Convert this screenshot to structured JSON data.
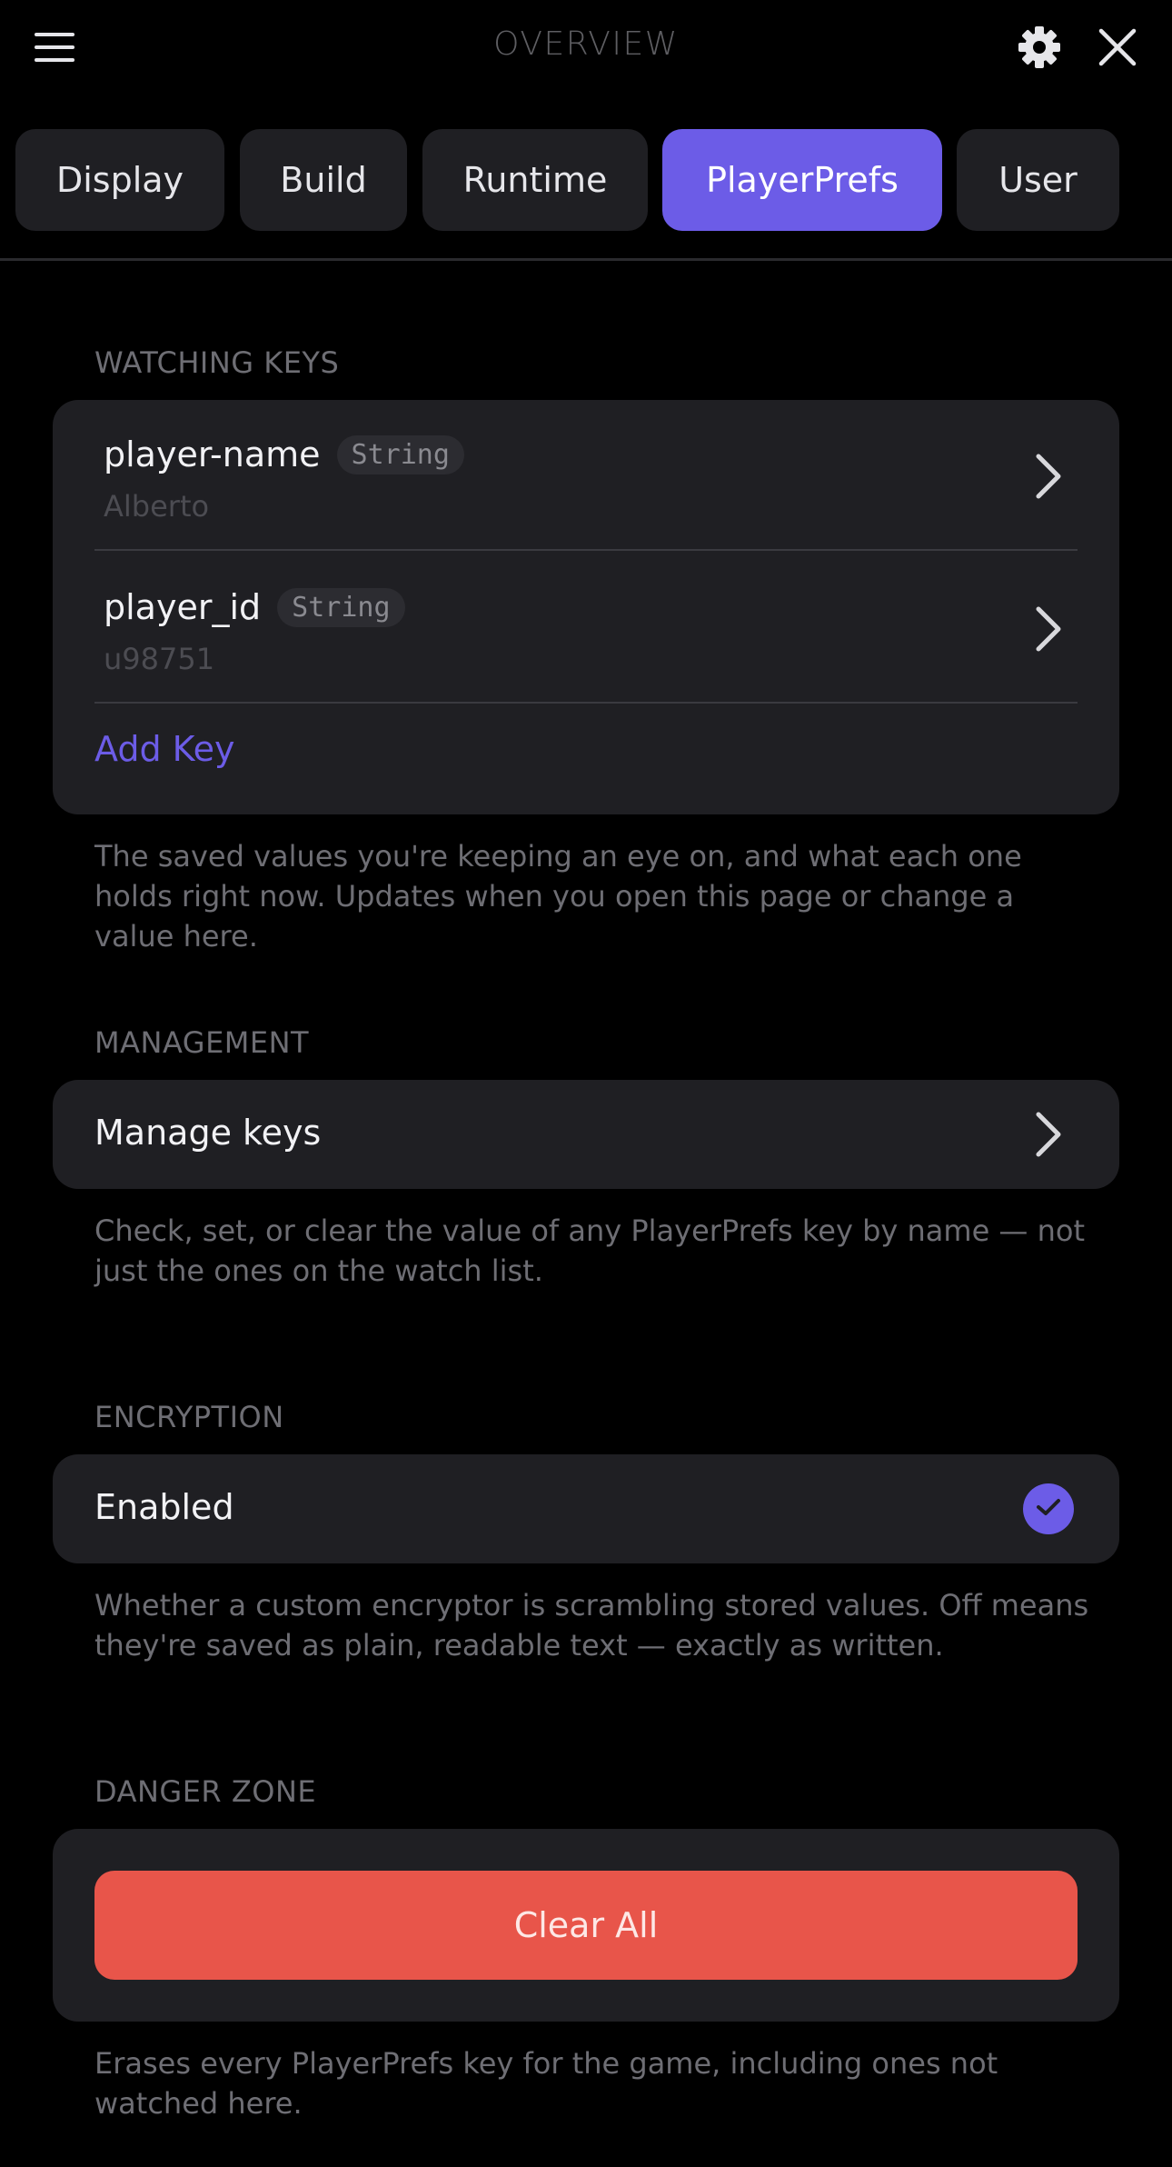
{
  "header": {
    "title": "OVERVIEW",
    "menu_icon": "hamburger-menu-icon",
    "settings_icon": "gear-icon",
    "close_icon": "close-icon"
  },
  "tabs": [
    {
      "label": "Display",
      "active": false
    },
    {
      "label": "Build",
      "active": false
    },
    {
      "label": "Runtime",
      "active": false
    },
    {
      "label": "PlayerPrefs",
      "active": true
    },
    {
      "label": "User",
      "active": false
    }
  ],
  "watching": {
    "section_label": "WATCHING KEYS",
    "keys": [
      {
        "name": "player-name",
        "type": "String",
        "value": "Alberto"
      },
      {
        "name": "player_id",
        "type": "String",
        "value": "u98751"
      }
    ],
    "add_key_label": "Add Key",
    "description": "The saved values you're keeping an eye on, and what each one holds right now. Updates when you open this page or change a value here."
  },
  "management": {
    "section_label": "MANAGEMENT",
    "row_label": "Manage keys",
    "description": "Check, set, or clear the value of any PlayerPrefs key by name — not just the ones on the watch list."
  },
  "encryption": {
    "section_label": "ENCRYPTION",
    "row_label": "Enabled",
    "checked": true,
    "description": "Whether a custom encryptor is scrambling stored values. Off means they're saved as plain, readable text — exactly as written."
  },
  "danger": {
    "section_label": "DANGER ZONE",
    "button_label": "Clear All",
    "description": "Erases every PlayerPrefs key for the game, including ones not watched here."
  },
  "colors": {
    "accent": "#6c5ce7",
    "danger": "#e8554a",
    "card": "#1f1f23",
    "background": "#000000"
  }
}
